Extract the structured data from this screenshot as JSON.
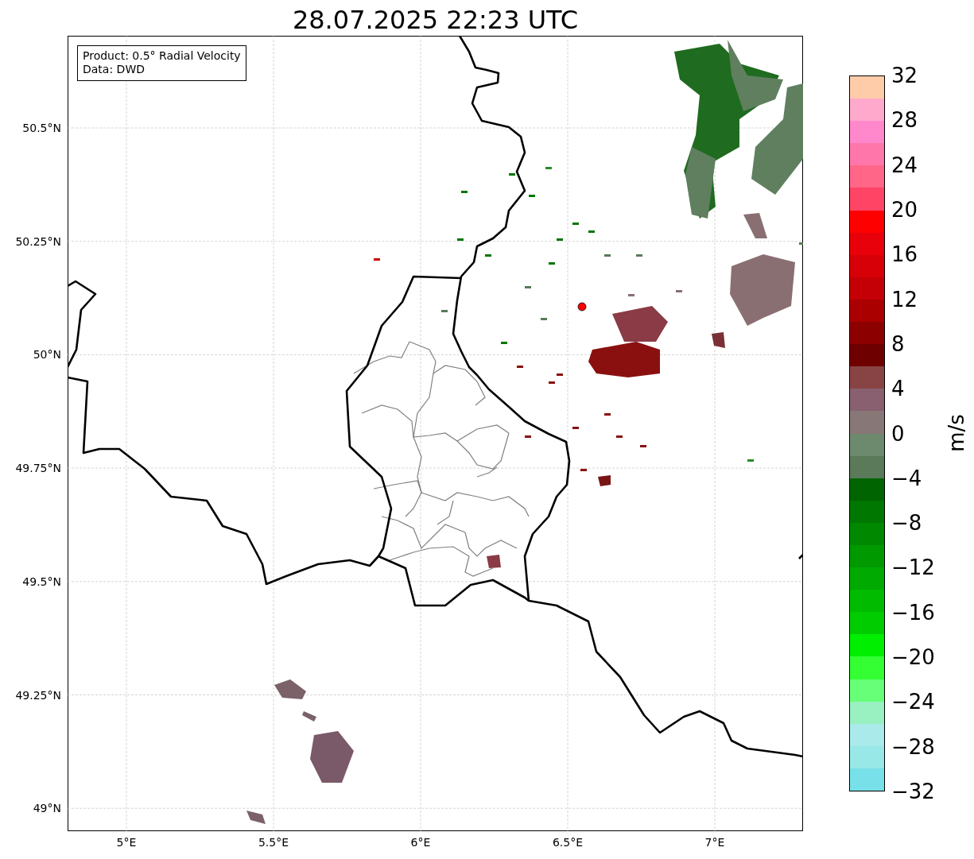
{
  "title": "28.07.2025 22:23 UTC",
  "legend": {
    "lines": [
      "Product: 0.5° Radial Velocity",
      "Data: DWD"
    ]
  },
  "map": {
    "lat_labels": [
      "50.5°N",
      "50.25°N",
      "50°N",
      "49.75°N",
      "49.5°N",
      "49.25°N",
      "49°N"
    ],
    "lon_labels": [
      "5°E",
      "5.5°E",
      "6°E",
      "6.5°E",
      "7°E"
    ]
  },
  "colorbar": {
    "label": "m/s",
    "ticks": [
      "32",
      "28",
      "24",
      "20",
      "16",
      "12",
      "8",
      "4",
      "0",
      "−4",
      "−8",
      "−12",
      "−16",
      "−20",
      "−24",
      "−28",
      "−32"
    ],
    "segments": [
      {
        "color": "#ffccaa"
      },
      {
        "color": "#ffaacc"
      },
      {
        "color": "#ff88cc"
      },
      {
        "color": "#ff77aa"
      },
      {
        "color": "#ff6688"
      },
      {
        "color": "#ff4466"
      },
      {
        "color": "#ff0000"
      },
      {
        "color": "#e8000a"
      },
      {
        "color": "#d80008"
      },
      {
        "color": "#c40006"
      },
      {
        "color": "#aa0000"
      },
      {
        "color": "#8c0000"
      },
      {
        "color": "#6e0000"
      },
      {
        "color": "#884444"
      },
      {
        "color": "#886070"
      },
      {
        "color": "#887777"
      },
      {
        "color": "#6e8a6e"
      },
      {
        "color": "#5a7a5a"
      },
      {
        "color": "#006400"
      },
      {
        "color": "#007700"
      },
      {
        "color": "#008800"
      },
      {
        "color": "#009900"
      },
      {
        "color": "#00aa00"
      },
      {
        "color": "#00bb00"
      },
      {
        "color": "#00cc00"
      },
      {
        "color": "#00ee00"
      },
      {
        "color": "#33ff33"
      },
      {
        "color": "#66ff77"
      },
      {
        "color": "#99f0c0"
      },
      {
        "color": "#aaeaea"
      },
      {
        "color": "#99e8e8"
      },
      {
        "color": "#77e0e8"
      }
    ]
  }
}
